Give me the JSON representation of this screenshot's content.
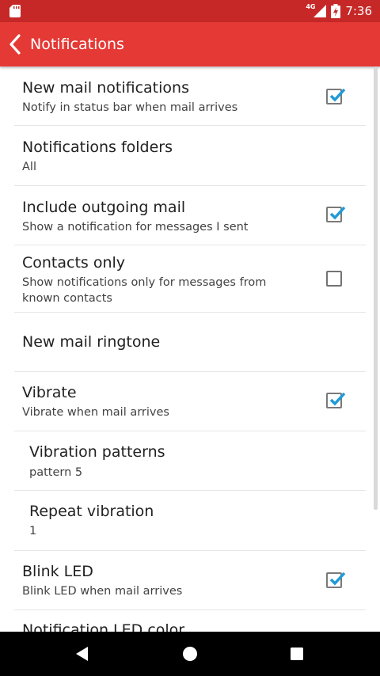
{
  "status_bar": {
    "network": "4G",
    "time": "7:36",
    "icons": [
      "sd-card-icon",
      "signal-icon",
      "battery-icon"
    ]
  },
  "app_bar": {
    "title": "Notifications",
    "back_icon": "chevron-left-icon"
  },
  "settings": [
    {
      "id": "new-mail-notifications",
      "title": "New mail notifications",
      "summary": "Notify in status bar when mail arrives",
      "checkbox": true,
      "checked": true
    },
    {
      "id": "notifications-folders",
      "title": "Notifications folders",
      "summary": "All"
    },
    {
      "id": "include-outgoing-mail",
      "title": "Include outgoing mail",
      "summary": "Show a notification for messages I sent",
      "checkbox": true,
      "checked": true
    },
    {
      "id": "contacts-only",
      "title": "Contacts only",
      "summary_line1": "Show notifications only for messages from",
      "summary_line2": "known contacts",
      "checkbox": true,
      "checked": false
    },
    {
      "id": "new-mail-ringtone",
      "title": "New mail ringtone"
    },
    {
      "id": "vibrate",
      "title": "Vibrate",
      "summary": "Vibrate when mail arrives",
      "checkbox": true,
      "checked": true
    },
    {
      "id": "vibration-patterns",
      "title": "Vibration patterns",
      "summary": "pattern 5"
    },
    {
      "id": "repeat-vibration",
      "title": "Repeat vibration",
      "summary": "1"
    },
    {
      "id": "blink-led",
      "title": "Blink LED",
      "summary": "Blink LED when mail arrives",
      "checkbox": true,
      "checked": true
    },
    {
      "id": "notification-led-color",
      "title": "Notification LED color"
    }
  ],
  "colors": {
    "status_bar": "#c62828",
    "app_bar": "#e53935",
    "check_accent": "#1e9bd7"
  },
  "nav_bar": {
    "icons": [
      "back-triangle-icon",
      "home-circle-icon",
      "recents-square-icon"
    ]
  }
}
